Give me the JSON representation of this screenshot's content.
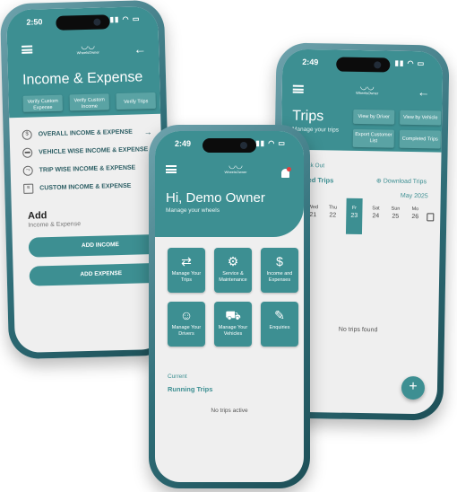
{
  "phone1": {
    "time": "2:50",
    "logo": "WheelsOwner",
    "title": "Income & Expense",
    "chips": [
      "Verify Custom Expense",
      "Verify Custom Income",
      "Verify Trips"
    ],
    "list": [
      {
        "label": "OVERALL INCOME & EXPENSE",
        "icon": "money-icon"
      },
      {
        "label": "VEHICLE WISE INCOME & EXPENSE",
        "icon": "car-icon"
      },
      {
        "label": "TRIP WISE INCOME & EXPENSE",
        "icon": "route-icon"
      },
      {
        "label": "CUSTOM INCOME & EXPENSE",
        "icon": "document-icon"
      }
    ],
    "add_heading": "Add",
    "add_sub": "Income & Expense",
    "btn_income": "ADD INCOME",
    "btn_expense": "ADD EXPENSE"
  },
  "phone2": {
    "time": "2:49",
    "logo": "WheelsOwner",
    "greeting": "Hi, Demo Owner",
    "sub": "Manage your wheels",
    "tiles": [
      {
        "label": "Manage Your Trips",
        "icon": "swap-icon"
      },
      {
        "label": "Service & Maintenance",
        "icon": "gear-icon"
      },
      {
        "label": "Income and Expenses",
        "icon": "cash-icon"
      },
      {
        "label": "Manage Your Drivers",
        "icon": "driver-icon"
      },
      {
        "label": "Manage Your Vehicles",
        "icon": "vehicles-icon"
      },
      {
        "label": "Enquiries",
        "icon": "edit-icon"
      }
    ],
    "current": "Current",
    "running": "Running Trips",
    "empty": "No trips active"
  },
  "phone3": {
    "time": "2:49",
    "logo": "WheelsOwner",
    "title": "Trips",
    "sub": "Manage your trips",
    "chips": [
      "View by Driver",
      "View by Vehicle",
      "Export Customer List",
      "Completed Trips"
    ],
    "checkout": "ck Out",
    "planned": "ned Trips",
    "download": "Download Trips",
    "month": "May 2025",
    "days": [
      {
        "n": "",
        "d": "21",
        "full": "Wed"
      },
      {
        "n": "",
        "d": "22",
        "full": "Thu"
      },
      {
        "n": "",
        "d": "23",
        "full": "Fr"
      },
      {
        "n": "",
        "d": "24",
        "full": "Sat"
      },
      {
        "n": "",
        "d": "25",
        "full": "Sun"
      },
      {
        "n": "",
        "d": "26",
        "full": "Mo"
      }
    ],
    "empty": "No trips found"
  },
  "colors": {
    "teal": "#3d8f92",
    "chip": "#5aa3a4"
  }
}
